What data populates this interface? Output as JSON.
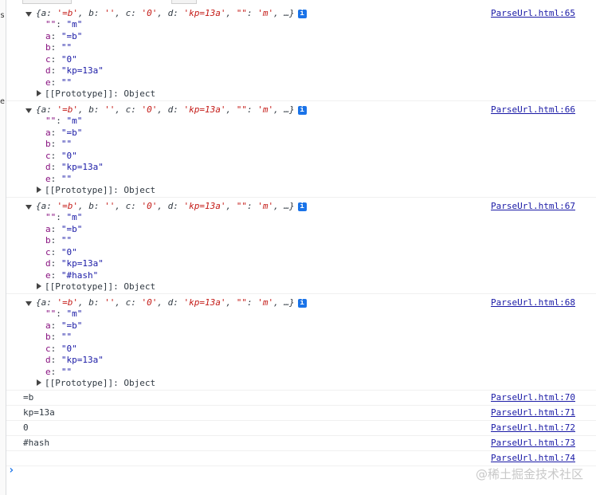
{
  "left_labels": [
    "s",
    "e"
  ],
  "objects": [
    {
      "summary_parts": [
        "{a: ",
        "'=b'",
        ", b: ",
        "''",
        ", c: ",
        "'0'",
        ", d: ",
        "'kp=13a'",
        ", ",
        "\"\"",
        ": ",
        "'m'",
        ", …}"
      ],
      "props": [
        {
          "k": "\"\"",
          "v": "\"m\""
        },
        {
          "k": "a",
          "v": "\"=b\""
        },
        {
          "k": "b",
          "v": "\"\""
        },
        {
          "k": "c",
          "v": "\"0\""
        },
        {
          "k": "d",
          "v": "\"kp=13a\""
        },
        {
          "k": "e",
          "v": "\"\""
        }
      ],
      "proto": "[[Prototype]]: Object",
      "source": "ParseUrl.html:65"
    },
    {
      "summary_parts": [
        "{a: ",
        "'=b'",
        ", b: ",
        "''",
        ", c: ",
        "'0'",
        ", d: ",
        "'kp=13a'",
        ", ",
        "\"\"",
        ": ",
        "'m'",
        ", …}"
      ],
      "props": [
        {
          "k": "\"\"",
          "v": "\"m\""
        },
        {
          "k": "a",
          "v": "\"=b\""
        },
        {
          "k": "b",
          "v": "\"\""
        },
        {
          "k": "c",
          "v": "\"0\""
        },
        {
          "k": "d",
          "v": "\"kp=13a\""
        },
        {
          "k": "e",
          "v": "\"\""
        }
      ],
      "proto": "[[Prototype]]: Object",
      "source": "ParseUrl.html:66"
    },
    {
      "summary_parts": [
        "{a: ",
        "'=b'",
        ", b: ",
        "''",
        ", c: ",
        "'0'",
        ", d: ",
        "'kp=13a'",
        ", ",
        "\"\"",
        ": ",
        "'m'",
        ", …}"
      ],
      "props": [
        {
          "k": "\"\"",
          "v": "\"m\""
        },
        {
          "k": "a",
          "v": "\"=b\""
        },
        {
          "k": "b",
          "v": "\"\""
        },
        {
          "k": "c",
          "v": "\"0\""
        },
        {
          "k": "d",
          "v": "\"kp=13a\""
        },
        {
          "k": "e",
          "v": "\"#hash\""
        }
      ],
      "proto": "[[Prototype]]: Object",
      "source": "ParseUrl.html:67"
    },
    {
      "summary_parts": [
        "{a: ",
        "'=b'",
        ", b: ",
        "''",
        ", c: ",
        "'0'",
        ", d: ",
        "'kp=13a'",
        ", ",
        "\"\"",
        ": ",
        "'m'",
        ", …}"
      ],
      "props": [
        {
          "k": "\"\"",
          "v": "\"m\""
        },
        {
          "k": "a",
          "v": "\"=b\""
        },
        {
          "k": "b",
          "v": "\"\""
        },
        {
          "k": "c",
          "v": "\"0\""
        },
        {
          "k": "d",
          "v": "\"kp=13a\""
        },
        {
          "k": "e",
          "v": "\"\""
        }
      ],
      "proto": "[[Prototype]]: Object",
      "source": "ParseUrl.html:68"
    }
  ],
  "simple_logs": [
    {
      "text": "=b",
      "source": "ParseUrl.html:70"
    },
    {
      "text": "kp=13a",
      "source": "ParseUrl.html:71"
    },
    {
      "text": "0",
      "source": "ParseUrl.html:72"
    },
    {
      "text": "#hash",
      "source": "ParseUrl.html:73"
    },
    {
      "text": "",
      "source": "ParseUrl.html:74"
    }
  ],
  "info_icon": "i",
  "prompt_symbol": "›",
  "watermark": "@稀土掘金技术社区",
  "colors": {
    "link": "#1a1aa6",
    "key": "#881280",
    "string": "#c41a16",
    "info": "#1a73e8"
  }
}
